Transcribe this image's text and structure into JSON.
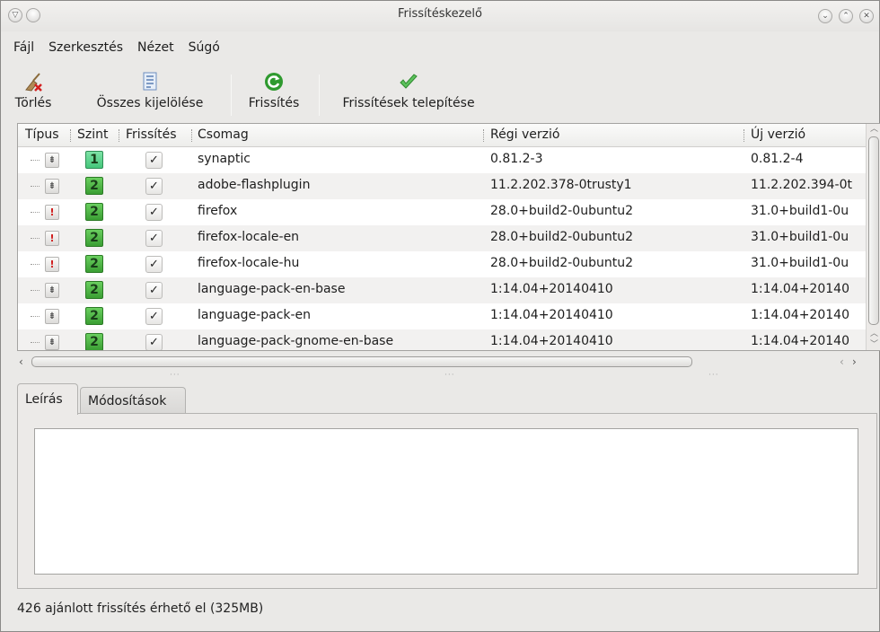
{
  "window": {
    "title": "Frissítéskezelő"
  },
  "menu": [
    {
      "label": "Fájl"
    },
    {
      "label": "Szerkesztés"
    },
    {
      "label": "Nézet"
    },
    {
      "label": "Súgó"
    }
  ],
  "toolbar": {
    "clear_label": "Törlés",
    "select_all_label": "Összes kijelölése",
    "refresh_label": "Frissítés",
    "install_label": "Frissítések telepítése"
  },
  "table": {
    "columns": {
      "type": "Típus",
      "level": "Szint",
      "update": "Frissítés",
      "package": "Csomag",
      "old_version": "Régi verzió",
      "new_version": "Új verzió"
    },
    "rows": [
      {
        "type": "normal",
        "level": "1",
        "checked": "✓",
        "package": "synaptic",
        "old_version": "0.81.2-3",
        "new_version": "0.81.2-4"
      },
      {
        "type": "normal",
        "level": "2",
        "checked": "✓",
        "package": "adobe-flashplugin",
        "old_version": "11.2.202.378-0trusty1",
        "new_version": "11.2.202.394-0t"
      },
      {
        "type": "security",
        "level": "2",
        "checked": "✓",
        "package": "firefox",
        "old_version": "28.0+build2-0ubuntu2",
        "new_version": "31.0+build1-0u"
      },
      {
        "type": "security",
        "level": "2",
        "checked": "✓",
        "package": "firefox-locale-en",
        "old_version": "28.0+build2-0ubuntu2",
        "new_version": "31.0+build1-0u"
      },
      {
        "type": "security",
        "level": "2",
        "checked": "✓",
        "package": "firefox-locale-hu",
        "old_version": "28.0+build2-0ubuntu2",
        "new_version": "31.0+build1-0u"
      },
      {
        "type": "normal",
        "level": "2",
        "checked": "✓",
        "package": "language-pack-en-base",
        "old_version": "1:14.04+20140410",
        "new_version": "1:14.04+20140"
      },
      {
        "type": "normal",
        "level": "2",
        "checked": "✓",
        "package": "language-pack-en",
        "old_version": "1:14.04+20140410",
        "new_version": "1:14.04+20140"
      },
      {
        "type": "normal",
        "level": "2",
        "checked": "✓",
        "package": "language-pack-gnome-en-base",
        "old_version": "1:14.04+20140410",
        "new_version": "1:14.04+20140"
      }
    ]
  },
  "tabs": {
    "description_label": "Leírás",
    "changes_label": "Módosítások"
  },
  "status": {
    "text": "426 ajánlott frissítés érhető el (325MB)"
  },
  "colors": {
    "level1": "#44c67a",
    "level2": "#3a9e33",
    "security": "#d01b1b",
    "refresh_icon": "#2f9a2f",
    "install_icon": "#3fae3f"
  }
}
